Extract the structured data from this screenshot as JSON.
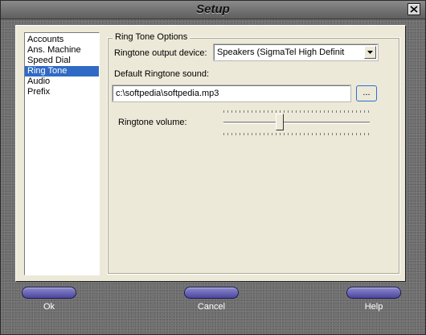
{
  "window": {
    "title": "Setup"
  },
  "sidebar": {
    "items": [
      {
        "label": "Accounts"
      },
      {
        "label": "Ans. Machine"
      },
      {
        "label": "Speed Dial"
      },
      {
        "label": "Ring Tone",
        "selected": true
      },
      {
        "label": "Audio"
      },
      {
        "label": "Prefix"
      }
    ]
  },
  "ringtone": {
    "group_title": "Ring Tone Options",
    "output_device_label": "Ringtone output device:",
    "output_device_value": "Speakers (SigmaTel High Definit",
    "default_sound_label": "Default Ringtone sound:",
    "default_sound_value": "c:\\softpedia\\softpedia.mp3",
    "browse_label": "...",
    "volume_label": "Ringtone volume:",
    "volume_fraction": 0.38
  },
  "footer": {
    "ok_label": "Ok",
    "cancel_label": "Cancel",
    "help_label": "Help"
  },
  "colors": {
    "selection": "#316ac5",
    "bottom_button": "#5d58b0"
  }
}
